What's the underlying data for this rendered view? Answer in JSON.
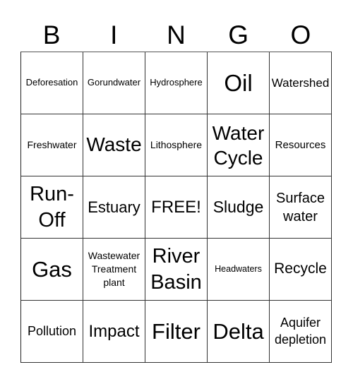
{
  "title_letters": [
    "B",
    "I",
    "N",
    "G",
    "O"
  ],
  "cells": [
    [
      "Deforesation",
      "Gorundwater",
      "Hydrosphere",
      "Oil",
      "Watershed"
    ],
    [
      "Freshwater",
      "Waste",
      "Lithosphere",
      "Water Cycle",
      "Resources"
    ],
    [
      "Run-Off",
      "Estuary",
      "FREE!",
      "Sludge",
      "Surface water"
    ],
    [
      "Gas",
      "Wastewater Treatment plant",
      "River Basin",
      "Headwaters",
      "Recycle"
    ],
    [
      "Pollution",
      "Impact",
      "Filter",
      "Delta",
      "Aquifer depletion"
    ]
  ],
  "free_space": {
    "row": 2,
    "col": 2,
    "label": "FREE!"
  }
}
